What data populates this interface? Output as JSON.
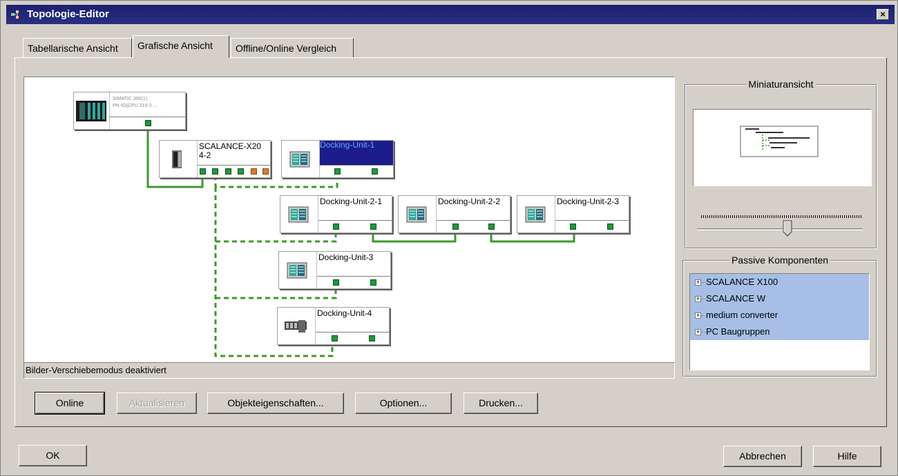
{
  "window": {
    "title": "Topologie-Editor",
    "close_glyph": "×"
  },
  "tabs": [
    {
      "label": "Tabellarische Ansicht"
    },
    {
      "label": "Grafische Ansicht"
    },
    {
      "label": "Offline/Online Vergleich"
    }
  ],
  "active_tab": 1,
  "topology": {
    "nodes": {
      "simatic": {
        "label_line1": "SIMATIC 300(1)",
        "label_line2": "PN-IO(CPU 319-3 ..."
      },
      "scalance": {
        "label": "SCALANCE-X20\n4-2"
      },
      "du1": {
        "label": "Docking-Unit-1"
      },
      "du21": {
        "label": "Docking-Unit-2-1"
      },
      "du22": {
        "label": "Docking-Unit-2-2"
      },
      "du23": {
        "label": "Docking-Unit-2-3"
      },
      "du3": {
        "label": "Docking-Unit-3"
      },
      "du4": {
        "label": "Docking-Unit-4"
      }
    },
    "status": "Bilder-Verschiebemodus deaktiviert",
    "colors": {
      "port": "#1c9a3c",
      "port_orange": "#e07a20",
      "link": "#3a9a2a",
      "selected": "#1c1c8c"
    }
  },
  "actions": {
    "online": "Online",
    "refresh": "Aktualisieren",
    "properties": "Objekteigenschaften...",
    "options": "Optionen...",
    "print": "Drucken..."
  },
  "miniature": {
    "title": "Miniaturansicht"
  },
  "passive": {
    "title": "Passive Komponenten",
    "items": [
      {
        "label": "SCALANCE X100"
      },
      {
        "label": "SCALANCE W"
      },
      {
        "label": "medium converter"
      },
      {
        "label": "PC Baugruppen"
      }
    ],
    "expander_glyph": "+"
  },
  "dialog": {
    "ok": "OK",
    "cancel": "Abbrechen",
    "help": "Hilfe"
  }
}
